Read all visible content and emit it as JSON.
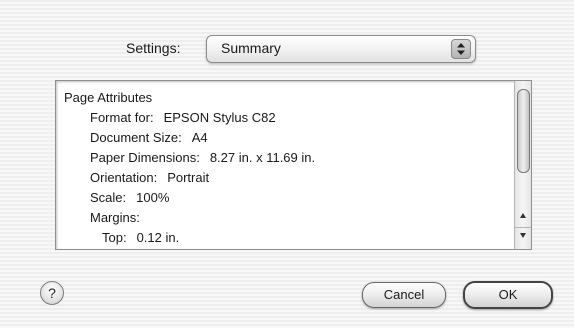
{
  "settings": {
    "label": "Settings:",
    "selected": "Summary"
  },
  "summary": {
    "section_title": "Page Attributes",
    "rows": [
      {
        "key": "Format for:",
        "value": "EPSON Stylus C82"
      },
      {
        "key": "Document Size:",
        "value": "A4"
      },
      {
        "key": "Paper Dimensions:",
        "value": "8.27 in. x 11.69 in."
      },
      {
        "key": "Orientation:",
        "value": "Portrait"
      },
      {
        "key": "Scale:",
        "value": "100%"
      }
    ],
    "margins_label": "Margins:",
    "margin_rows": [
      {
        "key": "Top:",
        "value": "0.12 in."
      }
    ]
  },
  "buttons": {
    "help": "?",
    "cancel": "Cancel",
    "ok": "OK"
  }
}
